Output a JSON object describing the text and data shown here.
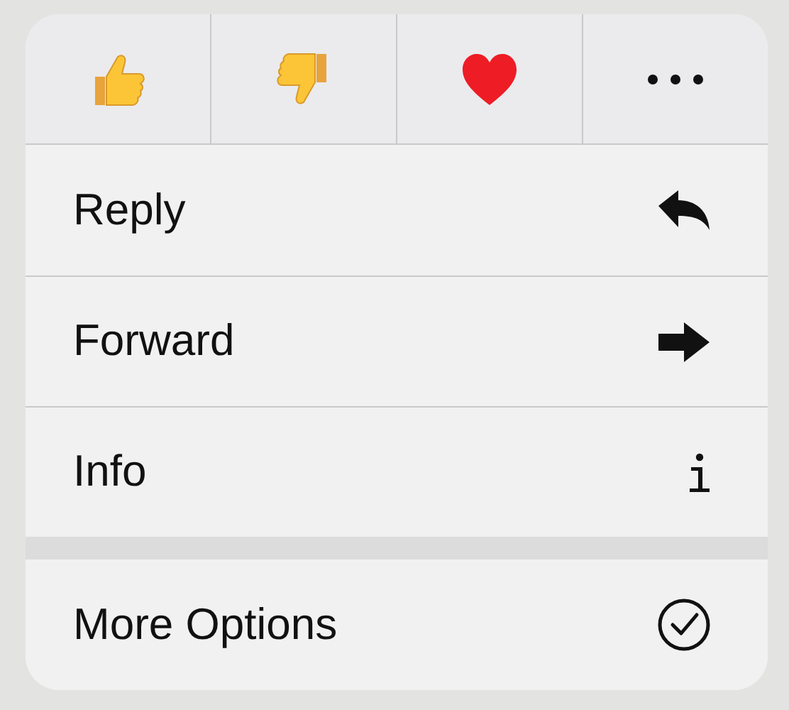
{
  "reactions": [
    {
      "kind": "thumbs_up"
    },
    {
      "kind": "thumbs_down"
    },
    {
      "kind": "heart"
    },
    {
      "kind": "more"
    }
  ],
  "sections": [
    {
      "items": [
        {
          "label": "Reply",
          "kind": "reply"
        },
        {
          "label": "Forward",
          "kind": "forward"
        },
        {
          "label": "Info",
          "kind": "info"
        }
      ]
    },
    {
      "items": [
        {
          "label": "More Options",
          "kind": "check"
        }
      ]
    }
  ]
}
